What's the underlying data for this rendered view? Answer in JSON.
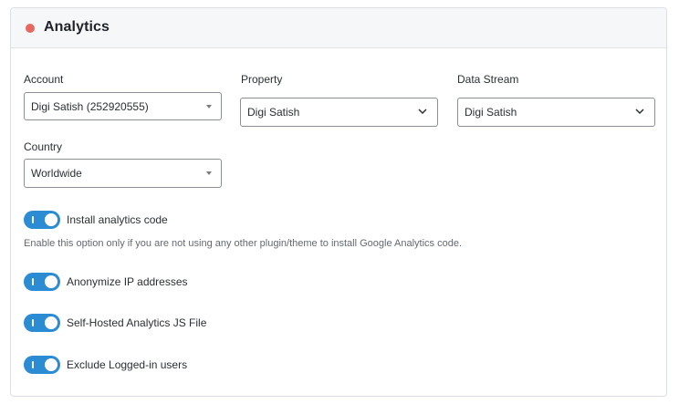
{
  "header": {
    "title": "Analytics",
    "status_color": "#e8685f"
  },
  "fields": {
    "account": {
      "label": "Account",
      "value": "Digi Satish (252920555)",
      "icon": "caret-down-icon"
    },
    "property": {
      "label": "Property",
      "value": "Digi Satish",
      "icon": "chevron-down-icon"
    },
    "data_stream": {
      "label": "Data Stream",
      "value": "Digi Satish",
      "icon": "chevron-down-icon"
    },
    "country": {
      "label": "Country",
      "value": "Worldwide",
      "icon": "caret-down-icon"
    }
  },
  "toggles": [
    {
      "label": "Install analytics code",
      "enabled": true,
      "help": "Enable this option only if you are not using any other plugin/theme to install Google Analytics code."
    },
    {
      "label": "Anonymize IP addresses",
      "enabled": true
    },
    {
      "label": "Self-Hosted Analytics JS File",
      "enabled": true
    },
    {
      "label": "Exclude Logged-in users",
      "enabled": true
    }
  ],
  "colors": {
    "toggle_on": "#2b8bd3",
    "border": "#8c8f94",
    "header_bg": "#f6f7f9"
  }
}
